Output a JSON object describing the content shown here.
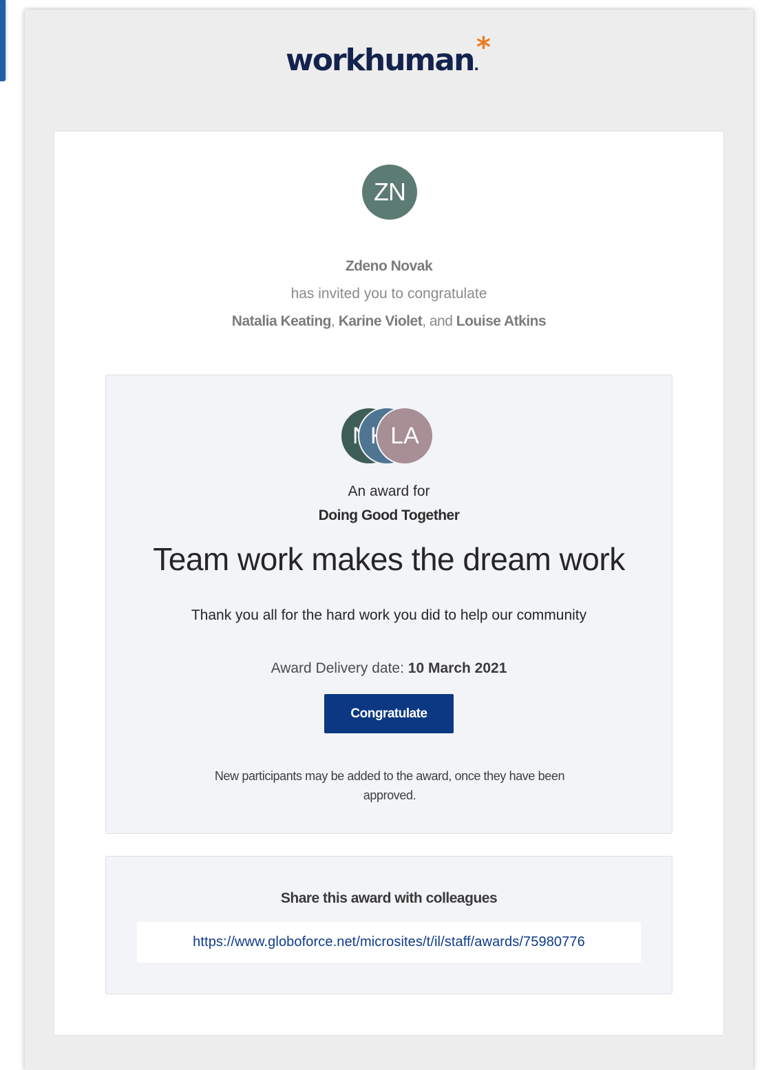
{
  "brand": {
    "logo_text": "workhuman",
    "logo_mark": "*",
    "logo_dot": ".",
    "accent_color": "#ea7c22",
    "logo_color": "#14234e"
  },
  "invitation": {
    "inviter_initials": "ZN",
    "inviter_avatar_color": "#5c7b73",
    "inviter_name": "Zdeno Novak",
    "invite_text": "has invited you to congratulate",
    "recipients": [
      {
        "name": "Natalia Keating",
        "initials": "NK",
        "avatar_color": "#3f5e57"
      },
      {
        "name": "Karine Violet",
        "initials": "KV",
        "avatar_color": "#4f7593"
      },
      {
        "name": "Louise Atkins",
        "initials": "LA",
        "avatar_color": "#a88e95"
      }
    ],
    "separator": ",",
    "conjunction": ", and"
  },
  "award": {
    "avatar_glyphs": [
      "N",
      "K",
      "LA"
    ],
    "award_for_label": "An award for",
    "award_name": "Doing Good Together",
    "title": "Team work makes the dream work",
    "message": "Thank you all for the hard work you did to help our community",
    "delivery_label": "Award Delivery date:",
    "delivery_date": "10 March 2021",
    "button_label": "Congratulate",
    "button_color": "#0c3883",
    "note": "New participants may be added to the award, once they have been approved."
  },
  "share": {
    "heading": "Share this award with colleagues",
    "url": "https://www.globoforce.net/microsites/t/il/staff/awards/75980776",
    "link_color": "#0f3a8a"
  }
}
